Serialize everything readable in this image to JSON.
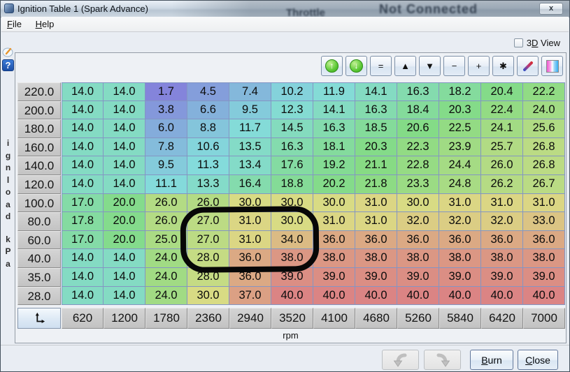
{
  "window": {
    "title": "Ignition Table 1 (Spark Advance)",
    "close_glyph": "x",
    "background_bleed_left": "Throttle",
    "background_bleed_right": "Not Connected"
  },
  "menu": {
    "file": {
      "u": "F",
      "rest": "ile"
    },
    "help": {
      "u": "H",
      "rest": "elp"
    }
  },
  "view3d": {
    "pre": "3",
    "u": "D",
    "rest": " View"
  },
  "side": {
    "help_glyph": "?",
    "ylabel_letters": [
      "i",
      "g",
      "n",
      "l",
      "o",
      "a",
      "d"
    ],
    "ylabel_unit_letters": [
      "k",
      "P",
      "a"
    ]
  },
  "toolbar": {
    "buttons": [
      {
        "name": "shift-values-up-button",
        "type": "circle",
        "glyph": "↑"
      },
      {
        "name": "shift-values-down-button",
        "type": "circle",
        "glyph": "↓"
      },
      {
        "name": "set-equal-button",
        "type": "glyph",
        "glyph": "="
      },
      {
        "name": "increase-value-button",
        "type": "glyph",
        "glyph": "▲"
      },
      {
        "name": "decrease-value-button",
        "type": "glyph",
        "glyph": "▼"
      },
      {
        "name": "minus-button",
        "type": "glyph",
        "glyph": "−"
      },
      {
        "name": "plus-button",
        "type": "glyph",
        "glyph": "+"
      },
      {
        "name": "scale-button",
        "type": "glyph",
        "glyph": "✱"
      },
      {
        "name": "edit-pencil-button",
        "type": "pencil"
      },
      {
        "name": "heatmap-toggle-button",
        "type": "gradient"
      }
    ]
  },
  "chart_data": {
    "type": "heatmap",
    "title": "Ignition Table 1 (Spark Advance)",
    "xlabel": "rpm",
    "ylabel": "ignload kPa",
    "x_bins": [
      620,
      1200,
      1780,
      2360,
      2940,
      3520,
      4100,
      4680,
      5260,
      5840,
      6420,
      7000
    ],
    "y_bins": [
      220.0,
      200.0,
      180.0,
      160.0,
      140.0,
      120.0,
      100.0,
      80.0,
      60.0,
      40.0,
      35.0,
      28.0
    ],
    "value_decimals": 1,
    "values": [
      [
        14.0,
        14.0,
        1.7,
        4.5,
        7.4,
        10.2,
        11.9,
        14.1,
        16.3,
        18.2,
        20.4,
        22.2
      ],
      [
        14.0,
        14.0,
        3.8,
        6.6,
        9.5,
        12.3,
        14.1,
        16.3,
        18.4,
        20.3,
        22.4,
        24.0
      ],
      [
        14.0,
        14.0,
        6.0,
        8.8,
        11.7,
        14.5,
        16.3,
        18.5,
        20.6,
        22.5,
        24.1,
        25.6
      ],
      [
        14.0,
        14.0,
        7.8,
        10.6,
        13.5,
        16.3,
        18.1,
        20.3,
        22.3,
        23.9,
        25.7,
        26.8
      ],
      [
        14.0,
        14.0,
        9.5,
        11.3,
        13.4,
        17.6,
        19.2,
        21.1,
        22.8,
        24.4,
        26.0,
        26.8
      ],
      [
        14.0,
        14.0,
        11.1,
        13.3,
        16.4,
        18.8,
        20.2,
        21.8,
        23.3,
        24.8,
        26.2,
        26.7
      ],
      [
        17.0,
        20.0,
        26.0,
        26.0,
        30.0,
        30.0,
        30.0,
        31.0,
        30.0,
        31.0,
        31.0,
        31.0
      ],
      [
        17.8,
        20.0,
        26.0,
        27.0,
        31.0,
        30.0,
        31.0,
        31.0,
        32.0,
        32.0,
        32.0,
        33.0
      ],
      [
        17.0,
        20.0,
        25.0,
        27.0,
        31.0,
        34.0,
        36.0,
        36.0,
        36.0,
        36.0,
        36.0,
        36.0
      ],
      [
        14.0,
        14.0,
        24.0,
        28.0,
        36.0,
        38.0,
        38.0,
        38.0,
        38.0,
        38.0,
        38.0,
        38.0
      ],
      [
        14.0,
        14.0,
        24.0,
        28.0,
        36.0,
        39.0,
        39.0,
        39.0,
        39.0,
        39.0,
        39.0,
        39.0
      ],
      [
        14.0,
        14.0,
        24.0,
        30.0,
        37.0,
        40.0,
        40.0,
        40.0,
        40.0,
        40.0,
        40.0,
        40.0
      ]
    ],
    "colormap": {
      "min_value": 1.7,
      "max_value": 40.0,
      "low_hue_deg": 240,
      "high_hue_deg": 0,
      "saturation_pct": 55,
      "lightness_pct": 69
    }
  },
  "annotation": {
    "shape": "hand-drawn-ellipse",
    "color": "#000000",
    "rows_circled": [
      80.0,
      60.0,
      40.0
    ],
    "rpm_circled": [
      2360,
      2940,
      3520
    ]
  },
  "footer": {
    "burn": {
      "u": "B",
      "rest": "urn"
    },
    "close": {
      "u": "C",
      "rest": "lose"
    }
  }
}
